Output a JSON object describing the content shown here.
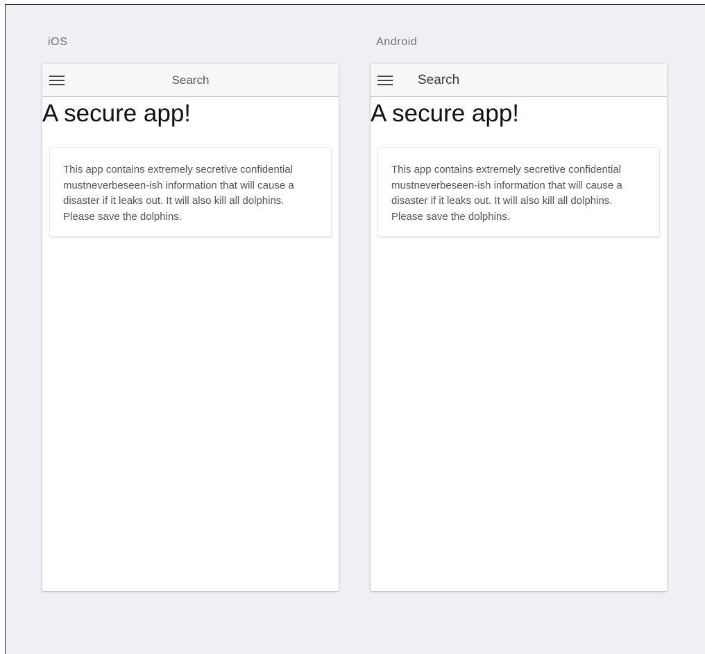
{
  "platforms": {
    "ios": {
      "label": "iOS",
      "toolbar": {
        "title": "Search",
        "menu_icon": "hamburger-menu-icon"
      },
      "heading": "A secure app!",
      "card": {
        "text": "This app contains extremely secretive confidential mustneverbeseen-ish information that will cause a disaster if it leaks out. It will also kill all dolphins. Please save the dolphins."
      }
    },
    "android": {
      "label": "Android",
      "toolbar": {
        "title": "Search",
        "menu_icon": "hamburger-menu-icon"
      },
      "heading": "A secure app!",
      "card": {
        "text": "This app contains extremely secretive confidential mustneverbeseen-ish information that will cause a disaster if it leaks out. It will also kill all dolphins. Please save the dolphins."
      }
    }
  },
  "colors": {
    "background": "#eff0f4",
    "device_background": "#ffffff",
    "toolbar_background": "#f7f7f7",
    "heading_text": "#111111",
    "body_text": "#555555",
    "label_text": "#6b6f76"
  }
}
